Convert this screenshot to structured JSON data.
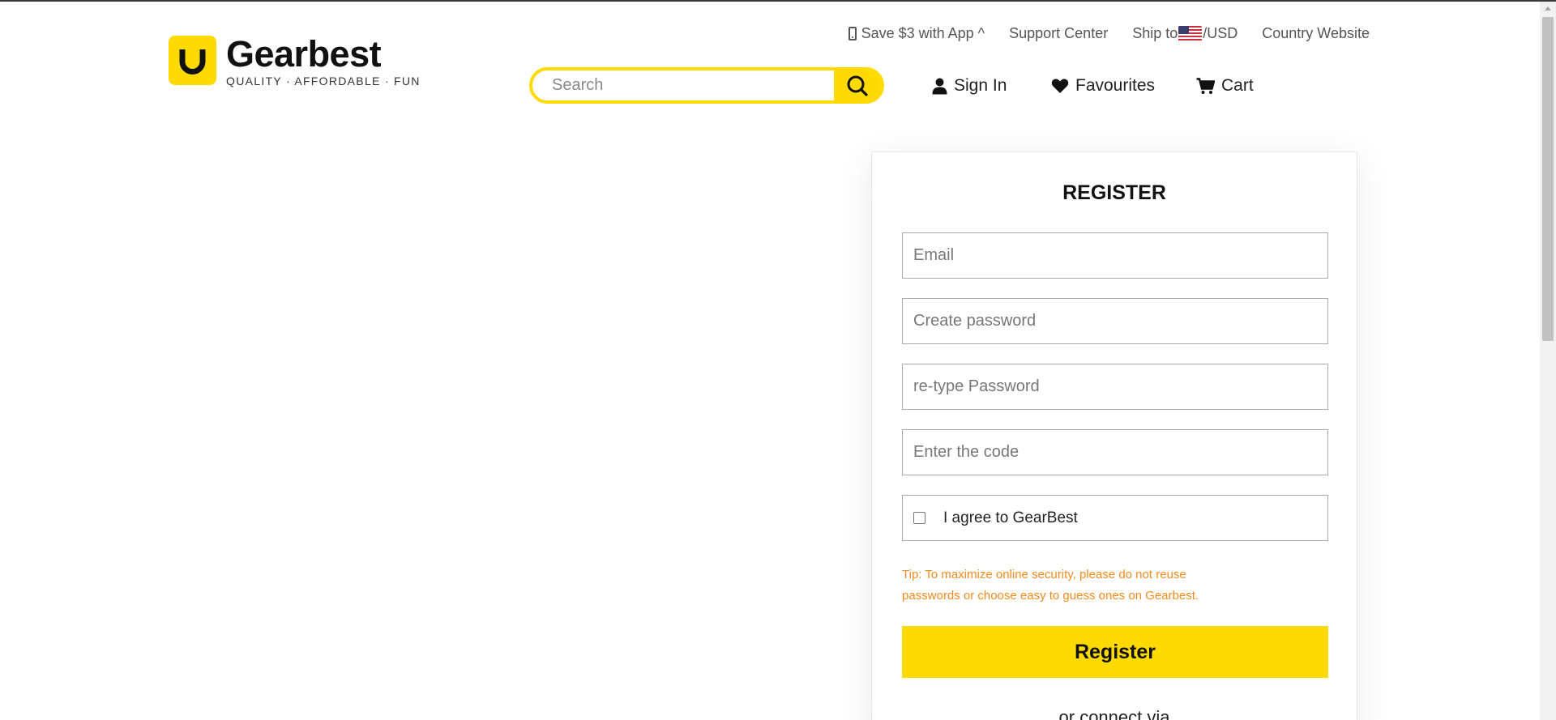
{
  "brand": {
    "name": "Gearbest",
    "tagline": "QUALITY · AFFORDABLE · FUN",
    "color": "#ffda00"
  },
  "top_links": {
    "app": "Save $3 with App ^",
    "support": "Support Center",
    "ship_prefix": "Ship to",
    "currency": "/USD",
    "country": "Country Website"
  },
  "search": {
    "placeholder": "Search"
  },
  "account_nav": {
    "sign_in": "Sign In",
    "favourites": "Favourites",
    "cart": "Cart"
  },
  "register_form": {
    "title": "REGISTER",
    "email_placeholder": "Email",
    "password_placeholder": "Create password",
    "retype_placeholder": "re-type Password",
    "code_placeholder": "Enter the code",
    "agree_label": "I agree to GearBest",
    "agree_checked": false,
    "tip": "Tip: To maximize online security, please do not reuse passwords or choose easy to guess ones on Gearbest.",
    "tip_color": "#f28b1c",
    "submit_label": "Register",
    "connect_text": "or connect via"
  }
}
